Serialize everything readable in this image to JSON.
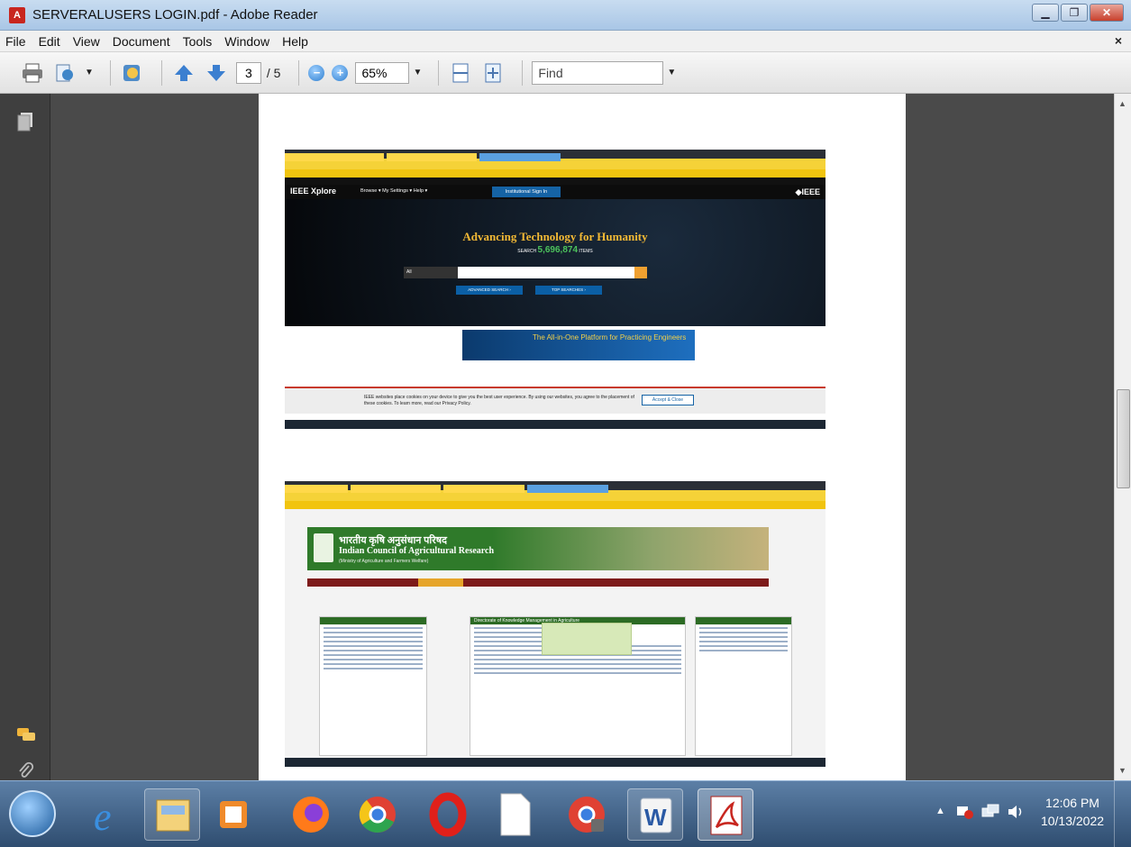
{
  "window": {
    "title": "SERVERALUSERS LOGIN.pdf - Adobe Reader",
    "min_label": "▁",
    "max_label": "❐",
    "close_label": "✕"
  },
  "menu": {
    "items": [
      "File",
      "Edit",
      "View",
      "Document",
      "Tools",
      "Window",
      "Help"
    ],
    "close_label": "×"
  },
  "toolbar": {
    "current_page": "3",
    "total_pages": "/ 5",
    "zoom": "65%",
    "find_placeholder": "Find",
    "zoom_out_label": "−",
    "zoom_in_label": "+"
  },
  "document": {
    "screenshot1": {
      "headline": "Advancing Technology for Humanity",
      "search_count": "5,696,874",
      "search_prefix": "SEARCH",
      "search_suffix": "ITEMS",
      "logo": "IEEE Xplore",
      "brand": "◆IEEE",
      "signin": "Institutional Sign In",
      "nav_text": "Browse ▾   My Settings ▾   Help ▾",
      "advanced_search": "ADVANCED SEARCH ›",
      "top_searches": "TOP SEARCHES ›",
      "ad_text": "The All-in-One Platform for Practicing Engineers",
      "cookie_text": "IEEE websites place cookies on your device to give you the best user experience. By using our websites, you agree to the placement of these cookies. To learn more, read our Privacy Policy.",
      "cookie_button": "Accept & Close"
    },
    "screenshot2": {
      "title_hindi": "भारतीय कृषि अनुसंधान परिषद",
      "title_english": "Indian Council of Agricultural Research",
      "subtitle": "(Ministry of Agriculture and Farmers Welfare)",
      "panel_heading": "Directorate of Knowledge Management in Agriculture"
    }
  },
  "taskbar": {
    "time": "12:06 PM",
    "date": "10/13/2022"
  },
  "colors": {
    "titlebar": "#b5cfea",
    "ieee_gold": "#f3b935",
    "icar_green": "#2f7a2a"
  }
}
